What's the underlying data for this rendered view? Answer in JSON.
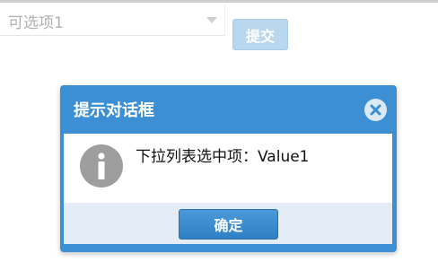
{
  "form": {
    "select_value": "可选项1",
    "submit_label": "提交"
  },
  "dialog": {
    "title": "提示对话框",
    "message": "下拉列表选中项：Value1",
    "confirm_label": "确定",
    "icon": "info-icon",
    "close_icon": "close-icon"
  },
  "colors": {
    "dialog_header": "#3d8fd3",
    "confirm_button": "#3a8acb",
    "submit_button_disabled": "#b9d7ee",
    "footer_bg": "#e4edf5"
  }
}
